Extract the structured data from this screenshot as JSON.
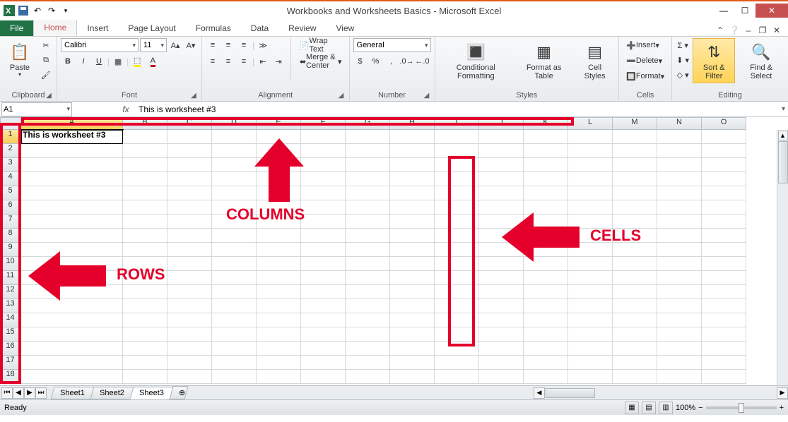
{
  "title": "Workbooks and Worksheets Basics - Microsoft Excel",
  "tabs": {
    "file": "File",
    "home": "Home",
    "insert": "Insert",
    "pagelayout": "Page Layout",
    "formulas": "Formulas",
    "data": "Data",
    "review": "Review",
    "view": "View"
  },
  "clipboard": {
    "paste": "Paste",
    "label": "Clipboard"
  },
  "font": {
    "name": "Calibri",
    "size": "11",
    "bold": "B",
    "italic": "I",
    "underline": "U",
    "label": "Font"
  },
  "alignment": {
    "wrap": "Wrap Text",
    "merge": "Merge & Center",
    "label": "Alignment"
  },
  "number": {
    "format": "General",
    "label": "Number",
    "currency": "$",
    "percent": "%",
    "comma": ",",
    "incdec_inc": "←.0",
    "incdec_dec": ".0→"
  },
  "styles": {
    "cond": "Conditional Formatting",
    "table": "Format as Table",
    "cell": "Cell Styles",
    "label": "Styles"
  },
  "cells": {
    "insert": "Insert",
    "delete": "Delete",
    "format": "Format",
    "label": "Cells"
  },
  "editing": {
    "sort": "Sort & Filter",
    "find": "Find & Select",
    "label": "Editing"
  },
  "namebox": "A1",
  "formula": "This is worksheet #3",
  "columns": [
    "A",
    "B",
    "C",
    "D",
    "E",
    "F",
    "G",
    "H",
    "I",
    "J",
    "K",
    "L",
    "M",
    "N",
    "O"
  ],
  "row_count": 18,
  "a1": "This is worksheet #3",
  "anno": {
    "rows": "ROWS",
    "cols": "COLUMNS",
    "cells": "CELLS"
  },
  "sheets": [
    "Sheet1",
    "Sheet2",
    "Sheet3"
  ],
  "active_sheet": 2,
  "status": "Ready",
  "zoom": "100%"
}
